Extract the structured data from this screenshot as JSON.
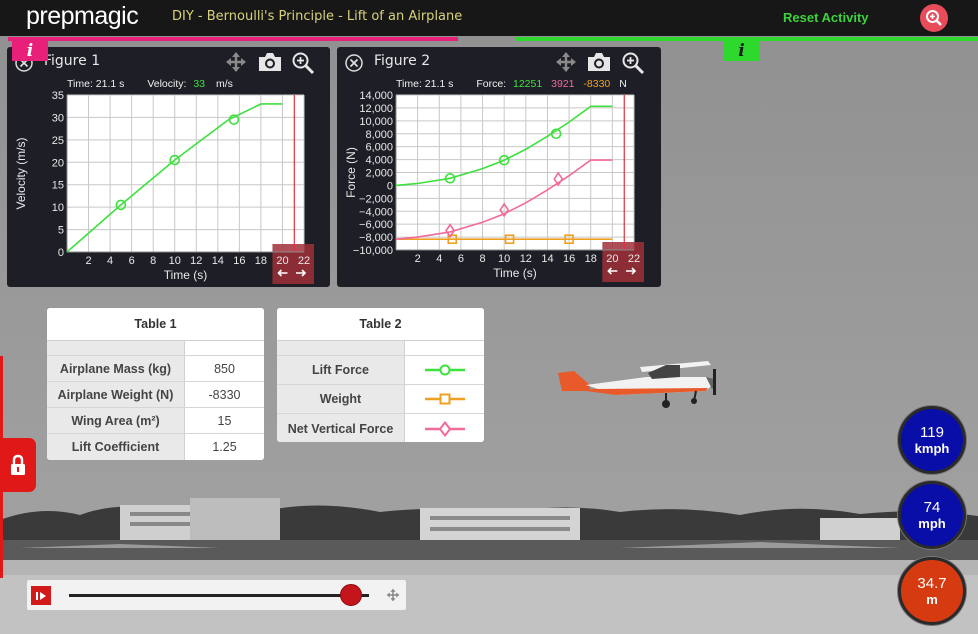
{
  "app": {
    "logo": "prepmagic",
    "title": "DIY - Bernoulli's Principle - Lift of an Airplane",
    "reset_label": "Reset Activity",
    "info_label": "i"
  },
  "colors": {
    "accent_pink": "#e8207a",
    "accent_green": "#2ed92e",
    "lift": "#3ee03e",
    "weight": "#f0a020",
    "net": "#f06a9a",
    "gauge_blue": "#0a0ea8",
    "gauge_orange": "#d63a10"
  },
  "figure1": {
    "title": "Figure 1",
    "time_label": "Time: 21.1 s",
    "velocity_label": "Velocity:",
    "velocity_value": "33",
    "velocity_unit": "m/s"
  },
  "figure2": {
    "title": "Figure 2",
    "time_label": "Time: 21.1 s",
    "force_label": "Force:",
    "lift_value": "12251",
    "net_value": "3921",
    "weight_value": "-8330",
    "force_unit": "N"
  },
  "chart_data": [
    {
      "type": "line",
      "xlabel": "Time (s)",
      "ylabel": "Velocity (m/s)",
      "xlim": [
        0,
        22
      ],
      "ylim": [
        0,
        35
      ],
      "xticks": [
        2,
        4,
        6,
        8,
        10,
        12,
        14,
        16,
        18,
        20,
        22
      ],
      "yticks": [
        0,
        5,
        10,
        15,
        20,
        25,
        30,
        35
      ],
      "grid": true,
      "cursor_x": 21.1,
      "series": [
        {
          "color": "#3ee03e",
          "marker": "circle",
          "x": [
            0,
            5,
            10,
            15,
            18,
            20
          ],
          "y": [
            0,
            10.5,
            20.5,
            29.5,
            33,
            33
          ],
          "markers_x": [
            5,
            10,
            15.5
          ],
          "markers_y": [
            10.5,
            20.5,
            29.5
          ]
        }
      ]
    },
    {
      "type": "line",
      "xlabel": "Time (s)",
      "ylabel": "Force (N)",
      "xlim": [
        0,
        22
      ],
      "ylim": [
        -10000,
        14000
      ],
      "xticks": [
        2,
        4,
        6,
        8,
        10,
        12,
        14,
        16,
        18,
        20,
        22
      ],
      "yticks": [
        -10000,
        -8000,
        -6000,
        -4000,
        -2000,
        0,
        2000,
        4000,
        6000,
        8000,
        10000,
        12000,
        14000
      ],
      "ytick_labels": [
        "−10,000",
        "−8,000",
        "−6,000",
        "−4,000",
        "−2,000",
        "0",
        "2,000",
        "4,000",
        "6,000",
        "8,000",
        "10,000",
        "12,000",
        "14,000"
      ],
      "grid": true,
      "cursor_x": 21.1,
      "series": [
        {
          "name": "Lift Force",
          "color": "#3ee03e",
          "marker": "circle",
          "x": [
            0,
            2,
            5,
            8,
            10,
            12,
            14,
            16,
            18,
            20
          ],
          "y": [
            0,
            300,
            1100,
            2600,
            3900,
            5600,
            7600,
            9800,
            12250,
            12250
          ],
          "markers_x": [
            5,
            10,
            14.8
          ],
          "markers_y": [
            1100,
            3900,
            8000
          ]
        },
        {
          "name": "Weight",
          "color": "#f0a020",
          "marker": "square",
          "x": [
            0,
            20
          ],
          "y": [
            -8330,
            -8330
          ],
          "markers_x": [
            5.2,
            10.5,
            16
          ],
          "markers_y": [
            -8330,
            -8330,
            -8330
          ]
        },
        {
          "name": "Net Vertical Force",
          "color": "#f06a9a",
          "marker": "diamond",
          "x": [
            0,
            2,
            5,
            8,
            10,
            12,
            14,
            16,
            18,
            20
          ],
          "y": [
            -8330,
            -8000,
            -7200,
            -5700,
            -4400,
            -2700,
            -700,
            1500,
            3920,
            3920
          ],
          "markers_x": [
            5,
            10,
            15
          ],
          "markers_y": [
            -7000,
            -3800,
            1000
          ]
        }
      ]
    }
  ],
  "table1": {
    "title": "Table 1",
    "rows": [
      {
        "label": "Airplane Mass (kg)",
        "value": "850"
      },
      {
        "label": "Airplane Weight (N)",
        "value": "-8330"
      },
      {
        "label": "Wing Area (m²)",
        "value": "15"
      },
      {
        "label": "Lift Coefficient",
        "value": "1.25"
      }
    ]
  },
  "table2": {
    "title": "Table 2",
    "rows": [
      {
        "label": "Lift Force",
        "marker": "circle",
        "color": "#3ee03e"
      },
      {
        "label": "Weight",
        "marker": "square",
        "color": "#f0a020"
      },
      {
        "label": "Net Vertical Force",
        "marker": "diamond",
        "color": "#f06a9a"
      }
    ]
  },
  "gauges": {
    "kmph_value": "119",
    "kmph_unit": "kmph",
    "mph_value": "74",
    "mph_unit": "mph",
    "dist_value": "34.7",
    "dist_unit": "m"
  },
  "playback": {
    "progress": 0.94
  },
  "icons": {
    "close": "close-icon",
    "move": "move-icon",
    "camera": "camera-icon",
    "zoom": "zoom-in-icon",
    "lock": "lock-icon",
    "play": "play-icon",
    "arrows": "arrow-left-icon / arrow-right-icon"
  }
}
